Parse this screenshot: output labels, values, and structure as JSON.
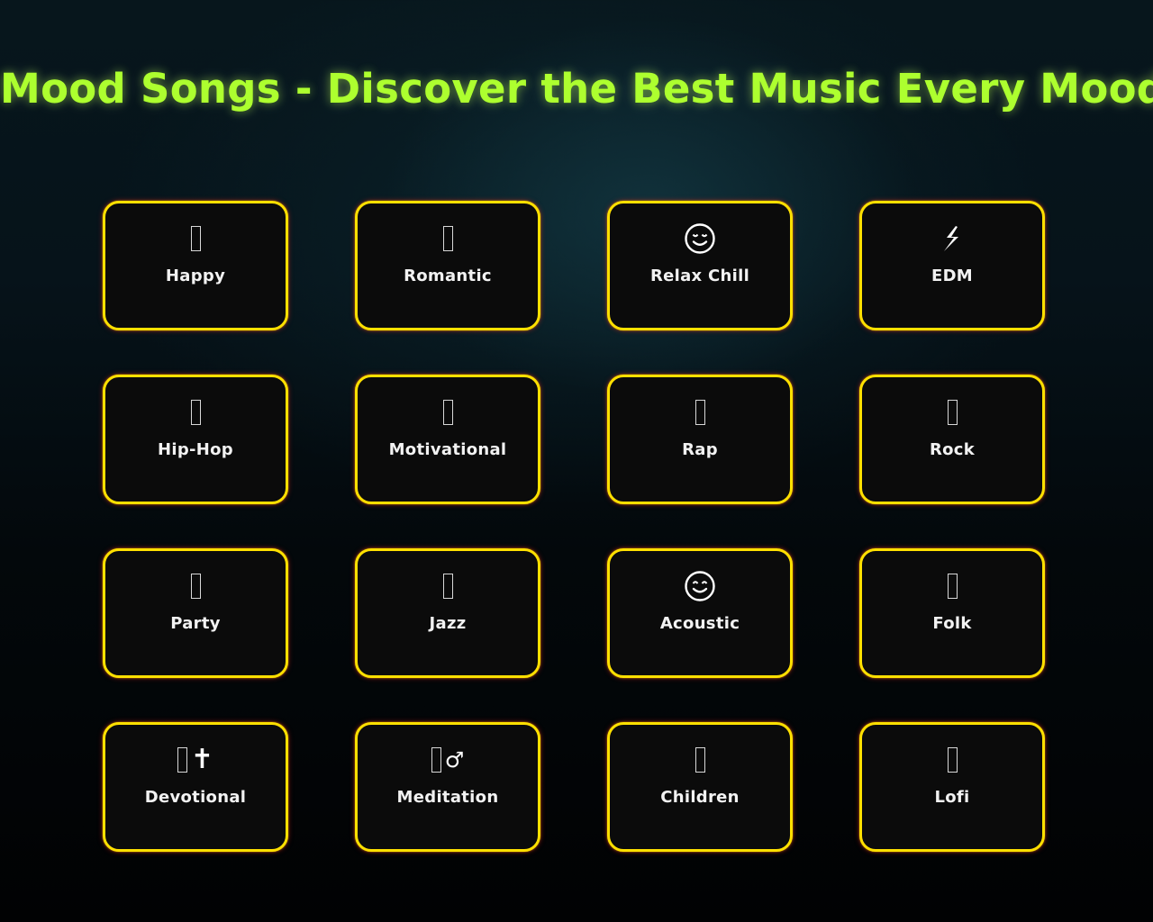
{
  "page": {
    "title": "Mood Songs - Discover the Best Music Every Mood",
    "title_trailing_icon": "missing-glyph"
  },
  "colors": {
    "title": "#adff2f",
    "card_border": "#ffe000",
    "card_background": "#0b0b0b",
    "card_glow": "#dc1e1e",
    "label": "#f2f2f2"
  },
  "moods": [
    {
      "label": "Happy",
      "icon": "missing-glyph",
      "glyph": ""
    },
    {
      "label": "Romantic",
      "icon": "missing-glyph",
      "glyph": ""
    },
    {
      "label": "Relax Chill",
      "icon": "relieved-face-icon",
      "glyph": "😌"
    },
    {
      "label": "EDM",
      "icon": "lightning-icon",
      "glyph": "⚡"
    },
    {
      "label": "Hip-Hop",
      "icon": "missing-glyph",
      "glyph": ""
    },
    {
      "label": "Motivational",
      "icon": "missing-glyph",
      "glyph": ""
    },
    {
      "label": "Rap",
      "icon": "missing-glyph",
      "glyph": ""
    },
    {
      "label": "Rock",
      "icon": "missing-glyph",
      "glyph": ""
    },
    {
      "label": "Party",
      "icon": "missing-glyph",
      "glyph": ""
    },
    {
      "label": "Jazz",
      "icon": "missing-glyph",
      "glyph": ""
    },
    {
      "label": "Acoustic",
      "icon": "smiling-face-icon",
      "glyph": "😊"
    },
    {
      "label": "Folk",
      "icon": "missing-glyph",
      "glyph": ""
    },
    {
      "label": "Devotional",
      "icon": "missing-glyph-plus-cross-icon",
      "glyph": "✝"
    },
    {
      "label": "Meditation",
      "icon": "missing-glyph-plus-male-sign-icon",
      "glyph": "♂"
    },
    {
      "label": "Children",
      "icon": "missing-glyph",
      "glyph": ""
    },
    {
      "label": "Lofi",
      "icon": "missing-glyph",
      "glyph": ""
    }
  ]
}
